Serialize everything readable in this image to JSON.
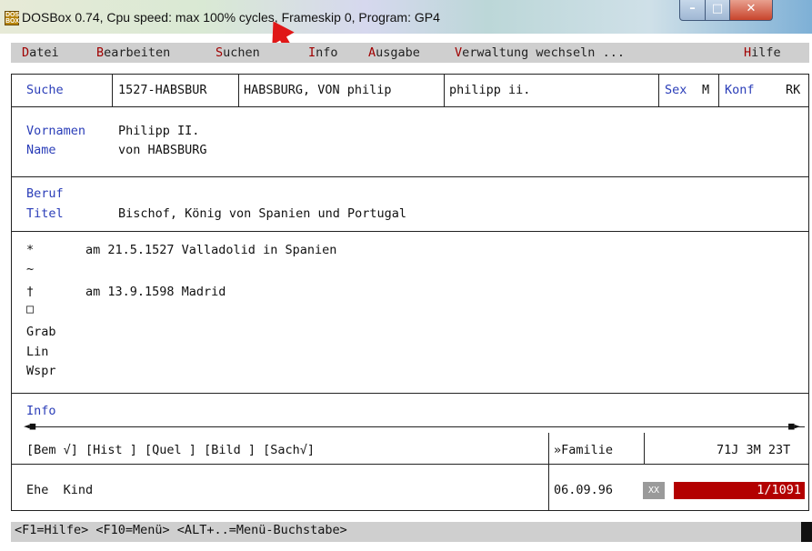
{
  "window": {
    "title": "DOSBox 0.74, Cpu speed: max 100% cycles, Frameskip  0, Program:     GP4"
  },
  "menu": {
    "items": [
      {
        "hot": "D",
        "rest": "atei"
      },
      {
        "hot": "B",
        "rest": "earbeiten"
      },
      {
        "hot": "S",
        "rest": "uchen"
      },
      {
        "hot": "I",
        "rest": "nfo"
      },
      {
        "hot": "A",
        "rest": "usgabe"
      },
      {
        "hot": "V",
        "rest": "erwaltung wechseln ..."
      },
      {
        "hot": "H",
        "rest": "ilfe"
      }
    ]
  },
  "search": {
    "label": "Suche",
    "key": "1527-HABSBUR",
    "name_field": "HABSBURG, VON philip",
    "first_field": "philipp ii.",
    "sex_label": "Sex",
    "sex_value": "M",
    "konf_label": "Konf",
    "konf_value": "RK"
  },
  "person": {
    "vornamen_label": "Vornamen",
    "vornamen_value": "Philipp II.",
    "name_label": "Name",
    "name_value": "von HABSBURG",
    "beruf_label": "Beruf",
    "titel_label": "Titel",
    "titel_value": "Bischof, König von Spanien und Portugal"
  },
  "events": {
    "birth_symbol": "*",
    "birth_value": "am 21.5.1527 Valladolid in Spanien",
    "baptism_symbol": "~",
    "death_symbol": "†",
    "death_value": "am 13.9.1598 Madrid",
    "burial_symbol": "□",
    "grab_label": "Grab",
    "lin_label": "Lin",
    "wspr_label": "Wspr"
  },
  "info": {
    "label": "Info",
    "flags": "[Bem √] [Hist ] [Quel ] [Bild ] [Sach√]",
    "familie": "»Familie",
    "age": "71J 3M 23T"
  },
  "footer": {
    "ehe_kind": "Ehe  Kind",
    "date": "06.09.96",
    "marker": "XX",
    "pager": "1/1091"
  },
  "status": {
    "text": "<F1=Hilfe> <F10=Menü> <ALT+..=Menü-Buchstabe>"
  }
}
